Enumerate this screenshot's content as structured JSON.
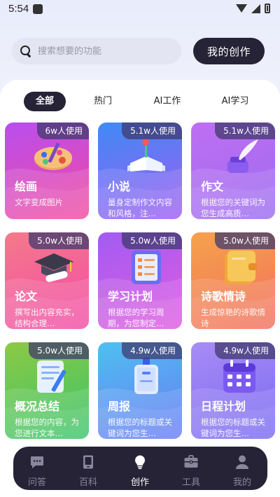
{
  "status_bar": {
    "time": "5:54"
  },
  "header": {
    "search_placeholder": "搜索想要的功能",
    "my_creation_label": "我的创作"
  },
  "tabs": [
    {
      "label": "全部",
      "active": true
    },
    {
      "label": "热门",
      "active": false
    },
    {
      "label": "AI工作",
      "active": false
    },
    {
      "label": "AI学习",
      "active": false
    }
  ],
  "cards": [
    {
      "usage": "6w人使用",
      "title": "绘画",
      "desc": "文字变成图片",
      "icon": "paint-palette-icon"
    },
    {
      "usage": "5.1w人使用",
      "title": "小说",
      "desc": "量身定制作文内容和风格，注…",
      "icon": "open-book-icon"
    },
    {
      "usage": "5.1w人使用",
      "title": "作文",
      "desc": "根据您的关键词为您生成高质…",
      "icon": "quill-ink-icon"
    },
    {
      "usage": "5.0w人使用",
      "title": "论文",
      "desc": "撰写出内容充实，结构合理…",
      "icon": "graduation-cap-icon"
    },
    {
      "usage": "5.0w人使用",
      "title": "学习计划",
      "desc": "根据您的学习周期，为您制定…",
      "icon": "checklist-icon"
    },
    {
      "usage": "5.0w人使用",
      "title": "诗歌情诗",
      "desc": "生成惊艳的诗歌情诗",
      "icon": "notebook-icon"
    },
    {
      "usage": "5.0w人使用",
      "title": "概况总结",
      "desc": "根据您的内容，为您进行文本…",
      "icon": "document-pen-icon"
    },
    {
      "usage": "4.9w人使用",
      "title": "周报",
      "desc": "根据您的标题或关键词为您生…",
      "icon": "id-badge-icon"
    },
    {
      "usage": "4.9w人使用",
      "title": "日程计划",
      "desc": "根据您的标题或关键词为您生…",
      "icon": "calendar-icon"
    }
  ],
  "colors": {
    "dark": "#262337",
    "card_gradients": [
      [
        "#b84ef0",
        "#f24b9e"
      ],
      [
        "#3e8bf5",
        "#a05cf2"
      ],
      [
        "#c06ef2",
        "#9b6cf0"
      ],
      [
        "#f57a8a",
        "#f24ba6"
      ],
      [
        "#a25cf2",
        "#e05be0"
      ],
      [
        "#f5a34b",
        "#f26f5e"
      ],
      [
        "#8ec944",
        "#39c46c"
      ],
      [
        "#4ec0f0",
        "#6a7cf5"
      ],
      [
        "#a88cf5",
        "#7a6af2"
      ]
    ]
  },
  "bottom_nav": [
    {
      "label": "问答",
      "icon": "chat-icon",
      "active": false
    },
    {
      "label": "百科",
      "icon": "tablet-icon",
      "active": false
    },
    {
      "label": "创作",
      "icon": "lightbulb-icon",
      "active": true
    },
    {
      "label": "工具",
      "icon": "toolbox-icon",
      "active": false
    },
    {
      "label": "我的",
      "icon": "user-icon",
      "active": false
    }
  ]
}
